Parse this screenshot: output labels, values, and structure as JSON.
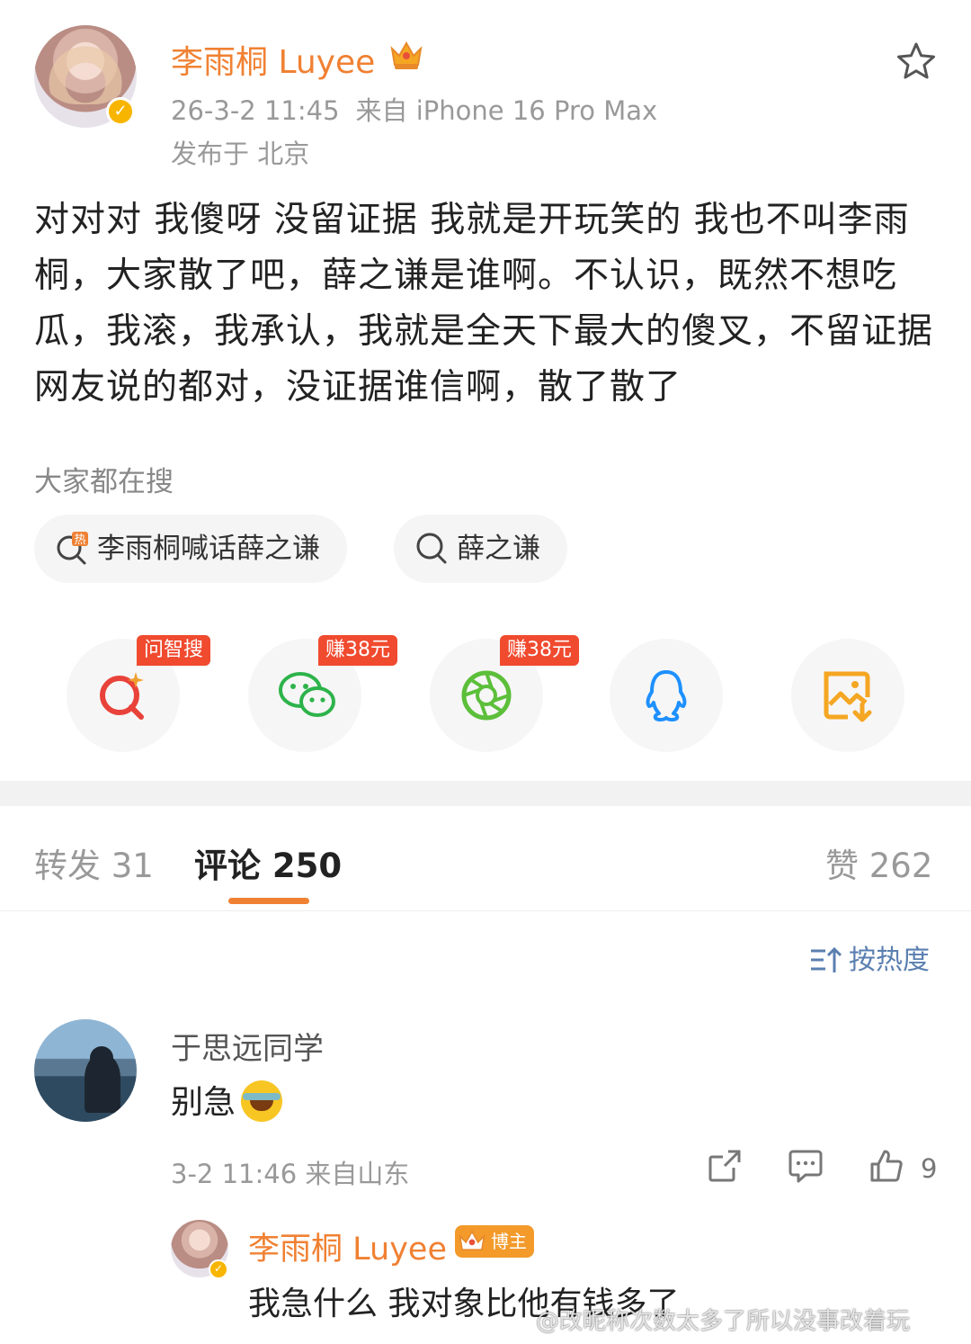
{
  "post": {
    "author": "李雨桐 Luyee",
    "time": "26-3-2 11:45",
    "source": "来自 iPhone 16 Pro Max",
    "location": "发布于 北京",
    "text": "对对对 我傻呀 没留证据 我就是开玩笑的 我也不叫李雨桐，大家散了吧，薛之谦是谁啊。不认识，既然不想吃瓜，我滚，我承认，我就是全天下最大的傻叉，不留证据 网友说的都对，没证据谁信啊，散了散了"
  },
  "search": {
    "title": "大家都在搜",
    "chips": [
      "李雨桐喊话薛之谦",
      "薛之谦"
    ],
    "hot_mark": "热"
  },
  "share": {
    "tags": [
      "问智搜",
      "赚38元",
      "赚38元"
    ],
    "icons": [
      "ai-search-icon",
      "wechat-icon",
      "moments-icon",
      "qq-icon",
      "save-image-icon"
    ]
  },
  "tabs": {
    "repost": "转发 31",
    "comment": "评论 250",
    "like": "赞 262"
  },
  "sort": {
    "label": "按热度"
  },
  "comment": {
    "name": "于思远同学",
    "text": "别急",
    "meta": "3-2 11:46 来自山东",
    "likes": "9"
  },
  "reply": {
    "name": "李雨桐 Luyee",
    "badge": "博主",
    "text": "我急什么 我对象比他有钱多了"
  },
  "watermark": "@改昵称次数太多了所以没事改着玩",
  "colors": {
    "accent": "#f08133",
    "verified": "#f7b500",
    "tag": "#f04a2f",
    "link": "#5a7fb0"
  }
}
